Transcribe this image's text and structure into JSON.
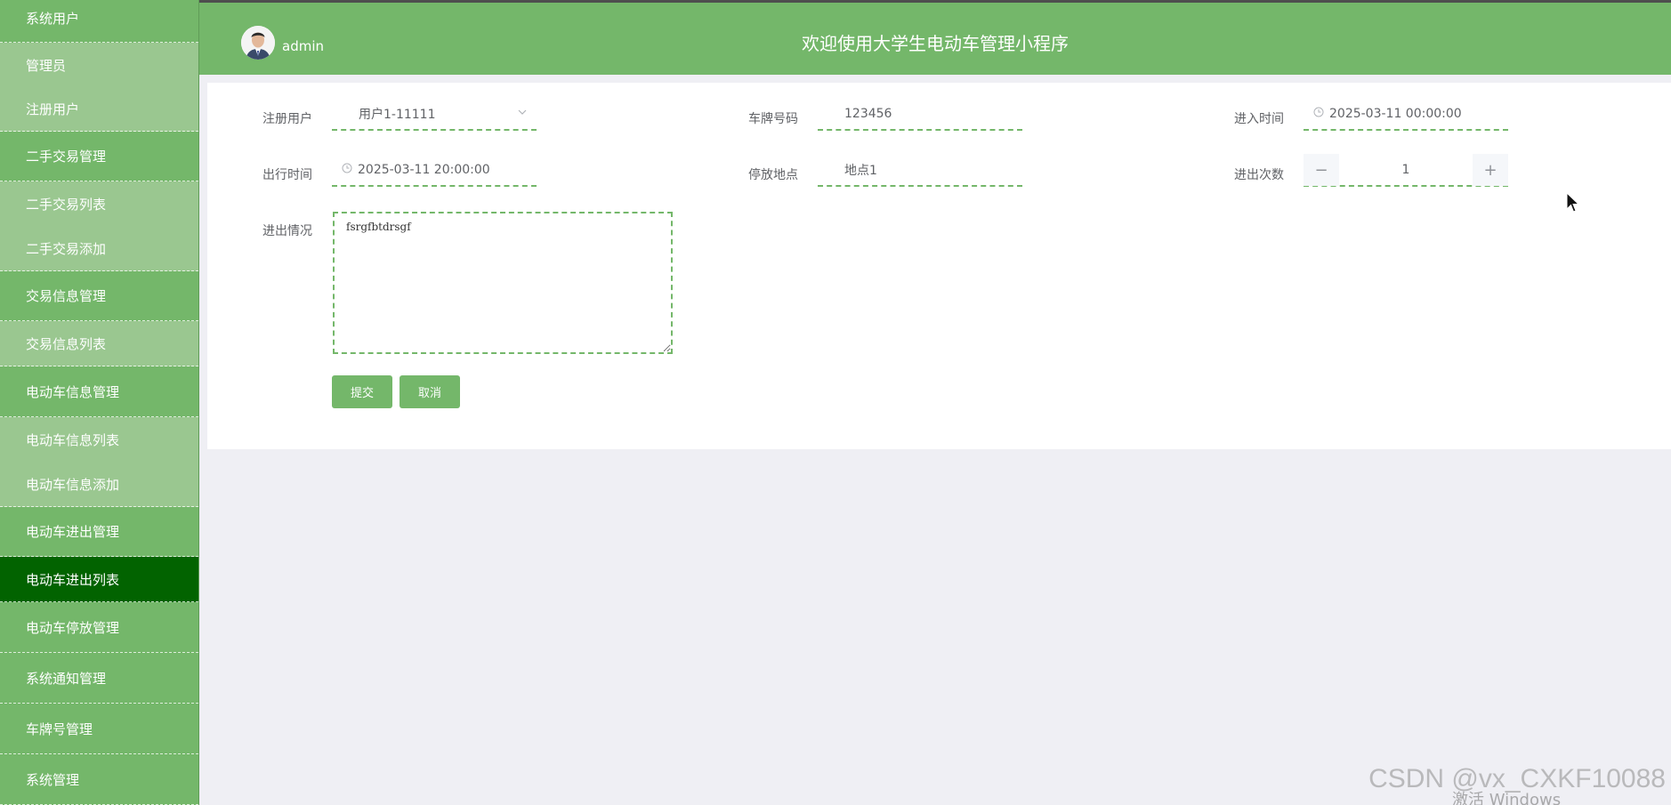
{
  "sidebar": {
    "items": [
      {
        "label": "系统用户",
        "kind": "group"
      },
      {
        "label": "管理员",
        "kind": "sub"
      },
      {
        "label": "注册用户",
        "kind": "sub"
      },
      {
        "label": "二手交易管理",
        "kind": "group"
      },
      {
        "label": "二手交易列表",
        "kind": "sub"
      },
      {
        "label": "二手交易添加",
        "kind": "sub"
      },
      {
        "label": "交易信息管理",
        "kind": "group"
      },
      {
        "label": "交易信息列表",
        "kind": "sub"
      },
      {
        "label": "电动车信息管理",
        "kind": "group"
      },
      {
        "label": "电动车信息列表",
        "kind": "sub"
      },
      {
        "label": "电动车信息添加",
        "kind": "sub"
      },
      {
        "label": "电动车进出管理",
        "kind": "group"
      },
      {
        "label": "电动车进出列表",
        "kind": "active"
      },
      {
        "label": "电动车停放管理",
        "kind": "group"
      },
      {
        "label": "系统通知管理",
        "kind": "group"
      },
      {
        "label": "车牌号管理",
        "kind": "group"
      },
      {
        "label": "系统管理",
        "kind": "group"
      }
    ]
  },
  "header": {
    "username": "admin",
    "title": "欢迎使用大学生电动车管理小程序"
  },
  "form": {
    "user_label": "注册用户",
    "user_value": "用户1-11111",
    "plate_label": "车牌号码",
    "plate_value": "123456",
    "enter_time_label": "进入时间",
    "enter_time_value": "2025-03-11 00:00:00",
    "exit_time_label": "出行时间",
    "exit_time_value": "2025-03-11 20:00:00",
    "location_label": "停放地点",
    "location_value": "地点1",
    "count_label": "进出次数",
    "count_value": "1",
    "count_minus": "−",
    "count_plus": "+",
    "status_label": "进出情况",
    "status_value": "fsrgfbtdrsgf",
    "submit_label": "提交",
    "cancel_label": "取消"
  },
  "overlay": {
    "watermark": "CSDN @vx_CXKF10088",
    "activate": "激活 Windows"
  },
  "colors": {
    "primary": "#74b76a",
    "sub_menu": "#9ac790",
    "active_menu": "#026300",
    "background": "#efeff4"
  }
}
